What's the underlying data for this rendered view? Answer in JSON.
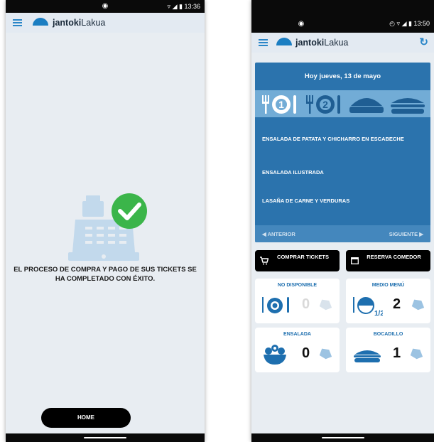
{
  "brand": {
    "bold": "jantoki",
    "regular": "Lakua"
  },
  "left_screen": {
    "status": {
      "time": "13:36",
      "signal": "▿ ◢ ▮"
    },
    "success_message": "EL PROCESO DE COMPRA Y PAGO DE SUS TICKETS SE HA COMPLETADO CON ÉXITO.",
    "home_label": "HOME"
  },
  "right_screen": {
    "status": {
      "time": "13:50",
      "alarm": "◴",
      "signal": "▿ ◢ ▮"
    },
    "refresh_icon": "↻",
    "date_heading": "Hoy jueves, 13 de mayo",
    "dishes": [
      "ENSALADA DE PATATA Y CHICHARRO EN ESCABECHE",
      "ENSALADA ILUSTRADA",
      "LASAÑA DE CARNE Y VERDURAS"
    ],
    "nav": {
      "prev": "◀  ANTERIOR",
      "next": "SIGUIENTE  ▶"
    },
    "buy_label": "COMPRAR TICKETS",
    "reserve_label": "RESERVA COMEDOR",
    "tickets": [
      {
        "title": "NO DISPONIBLE",
        "count": "0"
      },
      {
        "title": "MEDIO MENÚ",
        "count": "2"
      },
      {
        "title": "ENSALADA",
        "count": "0"
      },
      {
        "title": "BOCADILLO",
        "count": "1"
      }
    ],
    "half_label": "1/2",
    "menu_numbers": [
      "1",
      "2"
    ]
  },
  "colors": {
    "accent": "#2b73ad",
    "success": "#3bb54a",
    "background": "#e8edf2"
  }
}
